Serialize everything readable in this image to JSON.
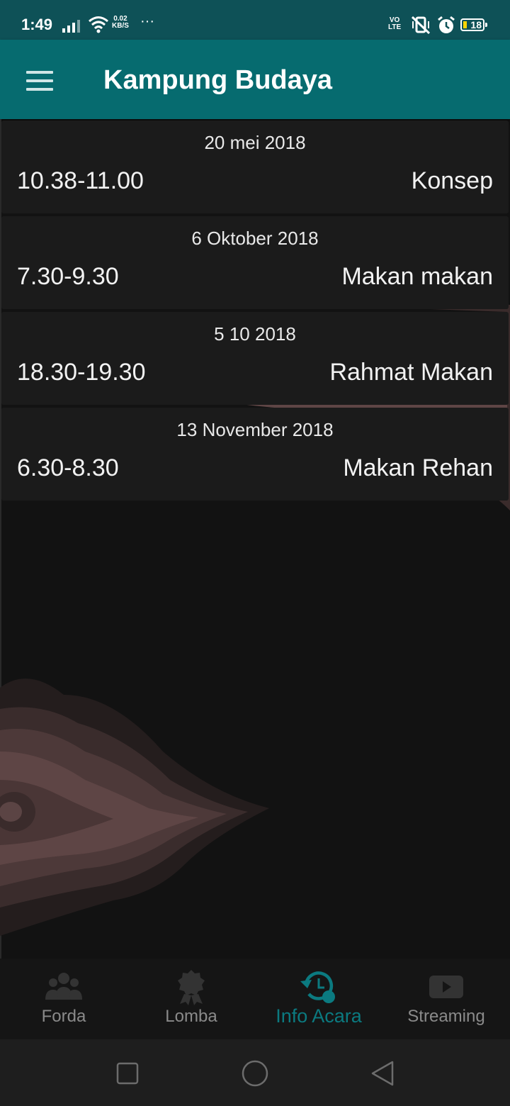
{
  "status_bar": {
    "time": "1:49",
    "net_speed_value": "0.02",
    "net_speed_unit": "KB/S",
    "more": "···",
    "volte_top": "VO",
    "volte_bottom": "LTE",
    "battery": "18",
    "icons": [
      "signal-icon",
      "wifi-icon",
      "vibrate-off-icon",
      "alarm-icon",
      "battery-icon"
    ]
  },
  "app_bar": {
    "title": "Kampung Budaya"
  },
  "events": [
    {
      "date": "20 mei 2018",
      "time": "10.38-11.00",
      "title": "Konsep"
    },
    {
      "date": "6 Oktober 2018",
      "time": "7.30-9.30",
      "title": "Makan makan"
    },
    {
      "date": "5 10 2018",
      "time": "18.30-19.30",
      "title": "Rahmat Makan"
    },
    {
      "date": "13 November 2018",
      "time": "6.30-8.30",
      "title": "Makan Rehan"
    }
  ],
  "bottom_nav": {
    "items": [
      {
        "label": "Forda",
        "icon": "group-icon"
      },
      {
        "label": "Lomba",
        "icon": "award-icon"
      },
      {
        "label": "Info Acara",
        "icon": "schedule-icon",
        "active": true
      },
      {
        "label": "Streaming",
        "icon": "youtube-icon"
      }
    ]
  },
  "colors": {
    "status_bar": "#0e5157",
    "app_bar": "#066b6f",
    "accent": "#0b7a80",
    "background": "#121212",
    "card": "#1b1b1b",
    "inactive": "#8a8a8a"
  }
}
